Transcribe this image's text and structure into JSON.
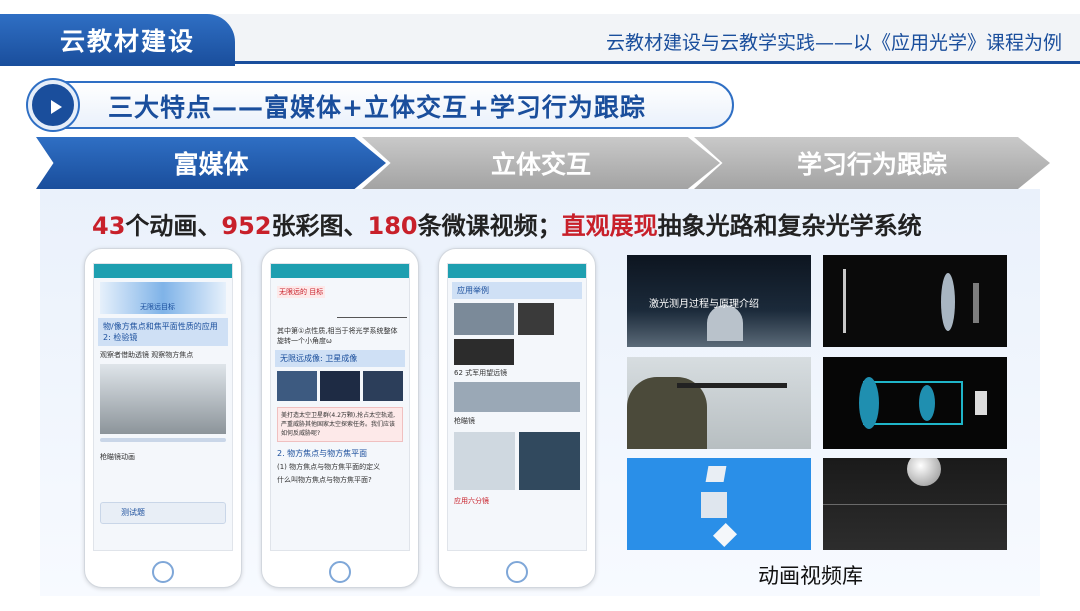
{
  "header": {
    "section_title": "云教材建设",
    "subtitle": "云教材建设与云教学实践——以《应用光学》课程为例"
  },
  "heading": {
    "title": "三大特点——富媒体+立体交互+学习行为跟踪",
    "icon": "play-icon"
  },
  "tabs": [
    {
      "label": "富媒体",
      "active": true
    },
    {
      "label": "立体交互",
      "active": false
    },
    {
      "label": "学习行为跟踪",
      "active": false
    }
  ],
  "headline": {
    "n_anim": "43",
    "t1": "个动画、",
    "n_img": "952",
    "t2": "张彩图、",
    "n_video": "180",
    "t3": "条微课视频；",
    "emph": "直观展现",
    "t4": "抽象光路和复杂光学系统"
  },
  "phones": [
    {
      "title_chip": "无限远目标",
      "banner": "物/像方焦点和焦平面性质的应用 2: 检验镜",
      "body": "观察者借助透镜 观察物方焦点",
      "caption": "枪瞄镜动画",
      "button": "测试题"
    },
    {
      "title_chip": "无限远的 目标",
      "body": "其中第①点性质,相当于将光学系统整体旋转一个小角度ω",
      "banner": "无限远成像: 卫星成像",
      "tip": "美打造太空卫星群(4.2万颗),抢占太空轨道,严重威胁其他国家太空探索任务。我们应该如何反威胁呢?",
      "section": "2. 物方焦点与物方焦平面",
      "sub": "(1) 物方焦点与物方焦平面的定义",
      "question": "什么叫物方焦点与物方焦平面?"
    },
    {
      "banner": "应用举例",
      "label1": "62 式军用望远镜",
      "label2": "枪瞄镜",
      "label3": "应用六分镜"
    }
  ],
  "thumbnails": [
    {
      "caption": "激光测月过程与原理介绍"
    },
    {
      "caption": ""
    },
    {
      "caption": ""
    },
    {
      "caption": ""
    },
    {
      "caption": ""
    },
    {
      "caption": ""
    }
  ],
  "library_label": "动画视频库",
  "colors": {
    "brand_blue": "#1a4e9c",
    "accent_red": "#c8202a",
    "inactive_gray": "#b3b3b3"
  }
}
